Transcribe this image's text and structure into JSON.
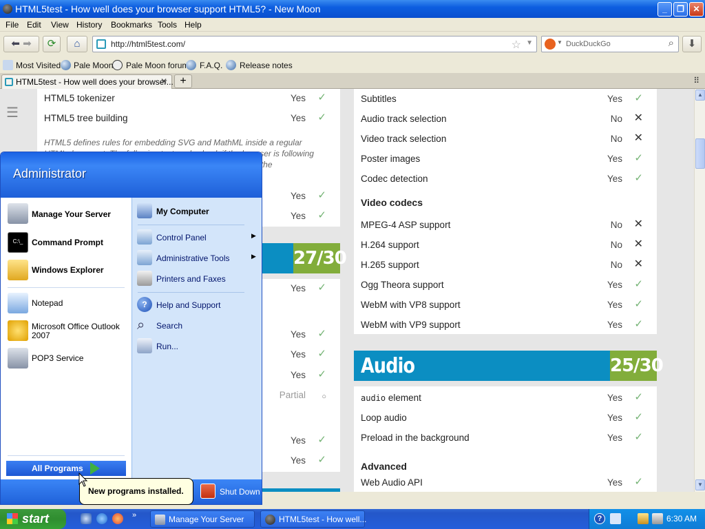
{
  "window": {
    "title": "HTML5test - How well does your browser support HTML5? - New Moon"
  },
  "menu": [
    "File",
    "Edit",
    "View",
    "History",
    "Bookmarks",
    "Tools",
    "Help"
  ],
  "address": {
    "url": "http://html5test.com/",
    "search_placeholder": "DuckDuckGo"
  },
  "bookmarks": [
    "Most Visited",
    "Pale Moon",
    "Pale Moon forum",
    "F.A.Q.",
    "Release notes"
  ],
  "tab": {
    "title": "HTML5test - How well does your browser...",
    "new_tab": "+"
  },
  "left_card": {
    "rows_top": [
      {
        "label": "HTML5 tokenizer",
        "value": "Yes"
      },
      {
        "label": "HTML5 tree building",
        "value": "Yes"
      }
    ],
    "note": "HTML5 defines rules for embedding SVG and MathML inside a regular HTML document. The following tests only check if the browser is following the HTML5 parsing rules for inline SVG and MathML, not if the",
    "rows_after_note": [
      {
        "value": "Yes"
      },
      {
        "value": "Yes"
      }
    ]
  },
  "left_banner": {
    "score": "27/30"
  },
  "left_card2": {
    "values": [
      "Yes",
      "Yes",
      "Yes",
      "Yes",
      "Partial",
      "Yes",
      "Yes"
    ]
  },
  "right_card": {
    "rows": [
      {
        "label": "Subtitles",
        "value": "Yes"
      },
      {
        "label": "Audio track selection",
        "value": "No"
      },
      {
        "label": "Video track selection",
        "value": "No"
      },
      {
        "label": "Poster images",
        "value": "Yes"
      },
      {
        "label": "Codec detection",
        "value": "Yes"
      }
    ],
    "codecs_heading": "Video codecs",
    "codecs": [
      {
        "label": "MPEG-4 ASP support",
        "value": "No"
      },
      {
        "label": "H.264 support",
        "value": "No"
      },
      {
        "label": "H.265 support",
        "value": "No"
      },
      {
        "label": "Ogg Theora support",
        "value": "Yes"
      },
      {
        "label": "WebM with VP8 support",
        "value": "Yes"
      },
      {
        "label": "WebM with VP9 support",
        "value": "Yes"
      }
    ]
  },
  "audio_banner": {
    "title": "Audio",
    "score": "25/30"
  },
  "audio_card": {
    "element_code": "audio",
    "element_suffix": " element",
    "rows": [
      {
        "label": "Loop audio",
        "value": "Yes"
      },
      {
        "label": "Preload in the background",
        "value": "Yes"
      }
    ],
    "element_value": "Yes",
    "advanced_heading": "Advanced",
    "advanced": [
      {
        "label": "Web Audio API",
        "value": "Yes"
      }
    ]
  },
  "start_menu": {
    "user": "Administrator",
    "pinned": [
      "Manage Your Server",
      "Command Prompt",
      "Windows Explorer"
    ],
    "recent": [
      "Notepad",
      "Microsoft Office Outlook",
      "2007",
      "POP3 Service"
    ],
    "right": [
      "My Computer",
      "Control Panel",
      "Administrative Tools",
      "Printers and Faxes",
      "Help and Support",
      "Search",
      "Run..."
    ],
    "all_programs": "All Programs",
    "shutdown": "Shut Down"
  },
  "balloon": "New programs installed.",
  "taskbar": {
    "start": "start",
    "tasks": [
      "Manage Your Server",
      "HTML5test - How well..."
    ],
    "clock": "6:30 AM"
  },
  "colors": {
    "banner": "#0b8ec2",
    "score": "#82ad3b",
    "xp_blue": "#245edb",
    "start_green": "#36a236"
  }
}
